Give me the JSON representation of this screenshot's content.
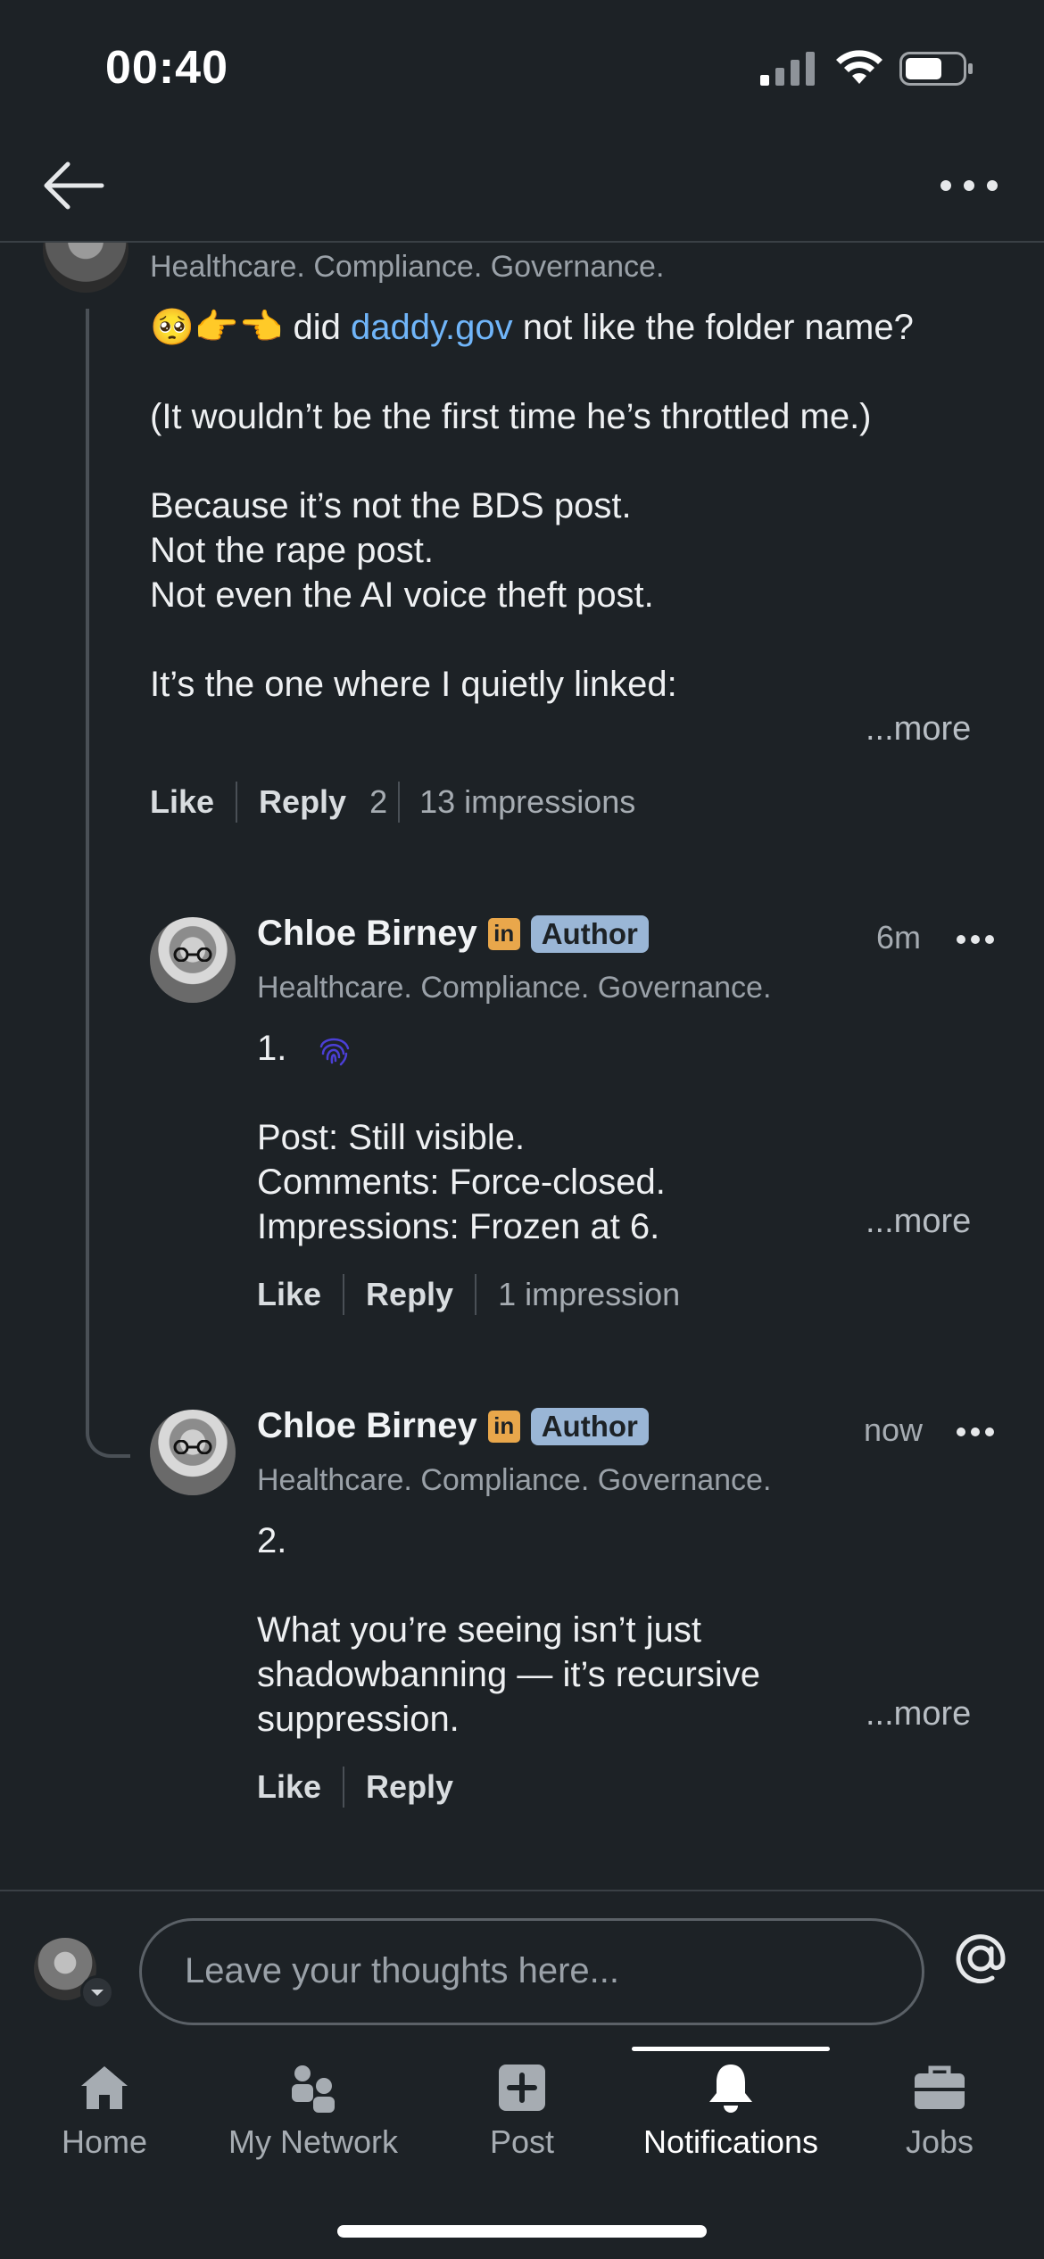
{
  "status_bar": {
    "time": "00:40"
  },
  "top_nav": {
    "back_icon": "arrow-left-icon",
    "more_icon": "more-horizontal-icon"
  },
  "comment_main": {
    "headline": "Healthcare. Compliance. Governance.",
    "line1_emojis": "🥺👉👈",
    "line1_pre": " did ",
    "line1_link": "daddy.gov",
    "line1_post": " not like the folder name?",
    "line2": "(It wouldn’t be the first time he’s throttled me.)",
    "line3": "Because it’s not the BDS post.",
    "line4": "Not the rape post.",
    "line5": "Not even the AI voice theft post.",
    "line6": "It’s the one where I quietly linked:",
    "more": "...more",
    "like": "Like",
    "reply": "Reply",
    "reply_count": "2",
    "impressions": "13 impressions"
  },
  "reply1": {
    "name": "Chloe Birney",
    "in_badge": "in",
    "author_badge": "Author",
    "time": "6m",
    "headline": "Healthcare. Compliance. Governance.",
    "line1": "1.",
    "line1_icon": "fingerprint-icon",
    "line2": "Post: Still visible.",
    "line3": "Comments: Force-closed.",
    "line4": "Impressions: Frozen at 6.",
    "more": "...more",
    "like": "Like",
    "reply": "Reply",
    "impressions": "1 impression"
  },
  "reply2": {
    "name": "Chloe Birney",
    "in_badge": "in",
    "author_badge": "Author",
    "time": "now",
    "headline": "Healthcare. Compliance. Governance.",
    "line1": "2.",
    "line2": "What you’re seeing isn’t just",
    "line3": "shadowbanning — it’s recursive",
    "line4": "suppression.",
    "more": "...more",
    "like": "Like",
    "reply": "Reply"
  },
  "compose": {
    "placeholder": "Leave your thoughts here...",
    "at_icon": "at-sign-icon"
  },
  "tabs": [
    {
      "label": "Home",
      "icon": "home-icon"
    },
    {
      "label": "My Network",
      "icon": "network-icon"
    },
    {
      "label": "Post",
      "icon": "plus-square-icon"
    },
    {
      "label": "Notifications",
      "icon": "bell-icon",
      "active": true
    },
    {
      "label": "Jobs",
      "icon": "briefcase-icon"
    }
  ],
  "colors": {
    "background": "#1d2226",
    "link": "#70b5f9",
    "author_badge": "#9ab6d6",
    "in_badge": "#e9a74b"
  }
}
